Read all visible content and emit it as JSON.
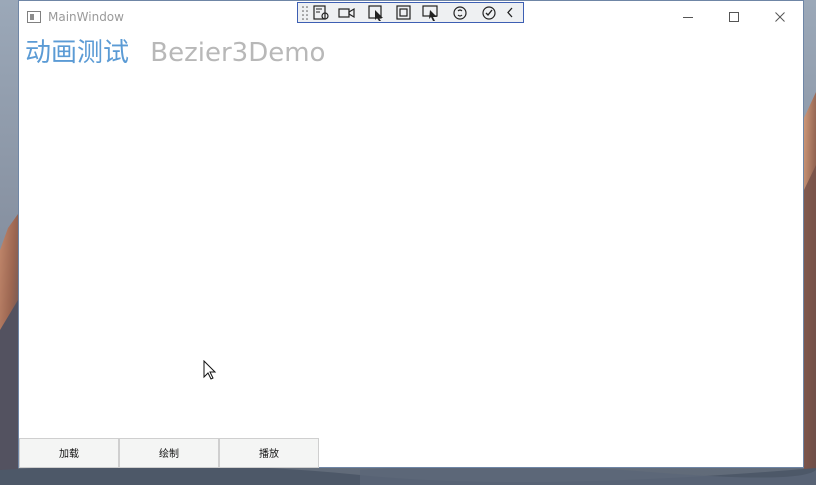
{
  "window": {
    "title": "MainWindow"
  },
  "debug_toolbar": {
    "tools": [
      "live-visual-tree-icon",
      "record-icon",
      "select-element-icon",
      "layout-adorners-icon",
      "track-focused-element-icon",
      "binding-failures-icon",
      "hot-reload-icon",
      "collapse-icon"
    ]
  },
  "content": {
    "title_chinese": "动画测试",
    "title_english": "Bezier3Demo"
  },
  "buttons": {
    "load_label": "加载",
    "draw_label": "绘制",
    "play_label": "播放"
  },
  "colors": {
    "heading_accent": "#5b9bd5",
    "heading_secondary": "#b8b8b8",
    "window_border": "#6f86a6",
    "toolbar_border": "#3d5fb3"
  }
}
